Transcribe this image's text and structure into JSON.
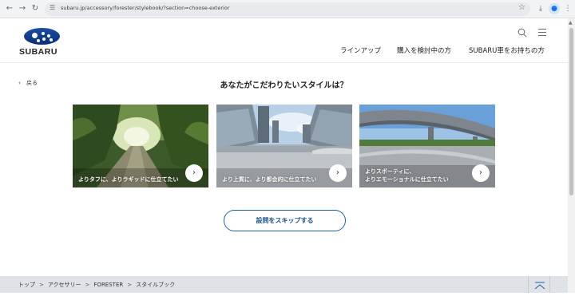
{
  "browser": {
    "url": "subaru.jp/accessory/forester/stylebook/?section=choose-exterior"
  },
  "header": {
    "logo_text": "SUBARU",
    "nav": [
      "ラインアップ",
      "購入を検討中の方",
      "SUBARU車をお持ちの方"
    ]
  },
  "main": {
    "back_label": "戻る",
    "title": "あなたがこだわりたいスタイルは？",
    "cards": [
      {
        "caption_lines": [
          "よりタフに、よりラギッドに仕立てたい"
        ],
        "scene": "forest-road"
      },
      {
        "caption_lines": [
          "より上質に、より都会的に仕立てたい"
        ],
        "scene": "city-plaza"
      },
      {
        "caption_lines": [
          "よりスポーティに、",
          "よりエモーショナルに仕立てたい"
        ],
        "scene": "highway"
      }
    ],
    "skip_label": "設問をスキップする"
  },
  "breadcrumb": {
    "items": [
      "トップ",
      "アクセサリー",
      "FORESTER",
      "スタイルブック"
    ],
    "separator": ">"
  },
  "colors": {
    "accent": "#1f5fa6",
    "breadcrumb_bg": "#dfe3e8"
  }
}
